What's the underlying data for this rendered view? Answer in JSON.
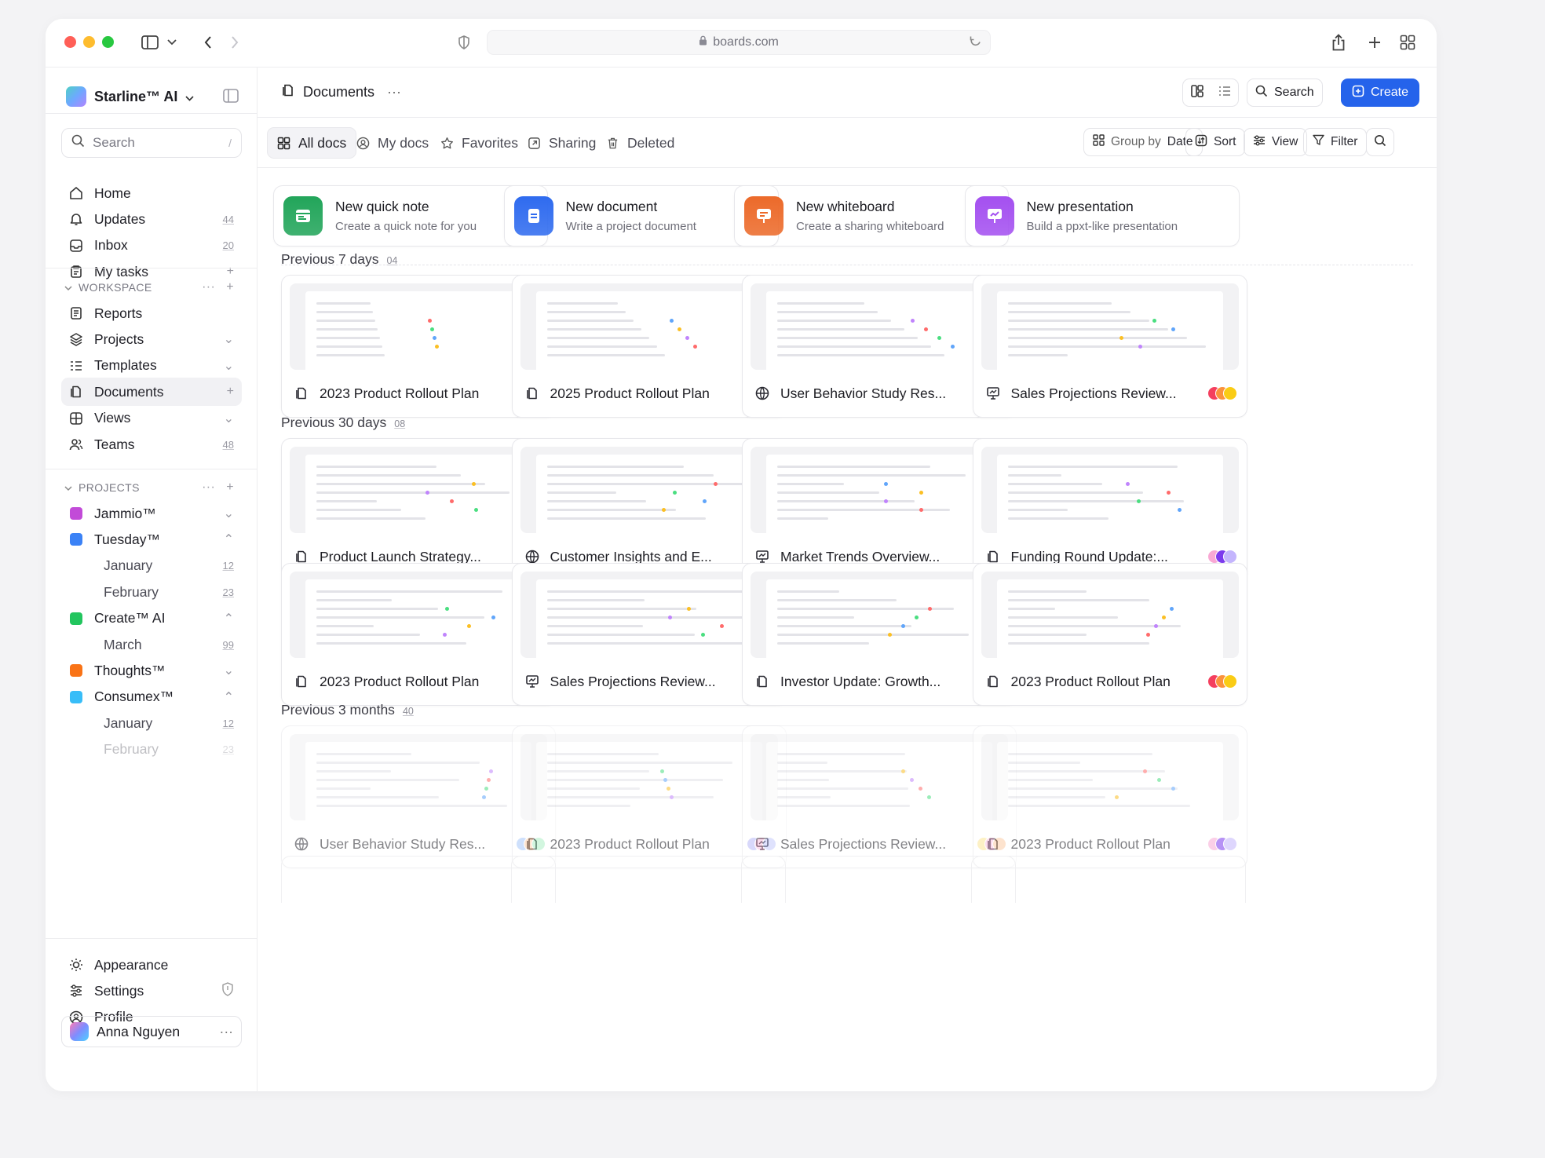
{
  "browser": {
    "url": "boards.com"
  },
  "sidebar": {
    "brand": "Starline™ AI",
    "search_placeholder": "Search",
    "search_shortcut": "/",
    "main_nav": [
      {
        "label": "Home",
        "icon": "home-icon",
        "right": ""
      },
      {
        "label": "Updates",
        "icon": "bell-icon",
        "right": "44"
      },
      {
        "label": "Inbox",
        "icon": "inbox-icon",
        "right": "20"
      },
      {
        "label": "My tasks",
        "icon": "clipboard-icon",
        "right": "+"
      }
    ],
    "workspace_label": "WORKSPACE",
    "workspace": [
      {
        "label": "Reports",
        "icon": "report-icon",
        "right": ""
      },
      {
        "label": "Projects",
        "icon": "layers-icon",
        "right": "⌄"
      },
      {
        "label": "Templates",
        "icon": "template-icon",
        "right": "⌄"
      },
      {
        "label": "Documents",
        "icon": "document-icon",
        "right": "+",
        "active": true
      },
      {
        "label": "Views",
        "icon": "grid-icon",
        "right": "⌄"
      },
      {
        "label": "Teams",
        "icon": "users-icon",
        "right": "48"
      }
    ],
    "projects_label": "PROJECTS",
    "projects": [
      {
        "label": "Jammio™",
        "color": "#c24bd8",
        "right": "⌄"
      },
      {
        "label": "Tuesday™",
        "color": "#3b82f6",
        "right": "⌃"
      },
      {
        "label": "January",
        "sub": true,
        "right": "12"
      },
      {
        "label": "February",
        "sub": true,
        "right": "23"
      },
      {
        "label": "Create™ AI",
        "color": "#22c55e",
        "right": "⌃"
      },
      {
        "label": "March",
        "sub": true,
        "right": "99"
      },
      {
        "label": "Thoughts™",
        "color": "#f97316",
        "right": "⌄"
      },
      {
        "label": "Consumex™",
        "color": "#38bdf8",
        "right": "⌃"
      },
      {
        "label": "January",
        "sub": true,
        "right": "12"
      },
      {
        "label": "February",
        "sub": true,
        "right": "23"
      }
    ],
    "bottom": [
      {
        "label": "Appearance",
        "icon": "sun-icon"
      },
      {
        "label": "Settings",
        "icon": "sliders-icon"
      },
      {
        "label": "Profile",
        "icon": "profile-icon"
      }
    ],
    "user": {
      "name": "Anna Nguyen",
      "more": "···"
    }
  },
  "header": {
    "title": "Documents",
    "more": "···",
    "search_label": "Search",
    "create_label": "Create"
  },
  "toolbar": {
    "tabs": [
      "All docs",
      "My docs",
      "Favorites",
      "Sharing",
      "Deleted"
    ],
    "group_by_prefix": "Group by",
    "group_by_value": "Date",
    "sort_label": "Sort",
    "view_label": "View",
    "filter_label": "Filter"
  },
  "quick_create": [
    {
      "title": "New quick note",
      "subtitle": "Create a quick note for you",
      "color": "#22a55a",
      "icon": "note-icon"
    },
    {
      "title": "New document",
      "subtitle": "Write a project document",
      "color": "#2f6bef",
      "icon": "document-icon"
    },
    {
      "title": "New whiteboard",
      "subtitle": "Create a sharing whiteboard",
      "color": "#ec6a2a",
      "icon": "whiteboard-icon"
    },
    {
      "title": "New presentation",
      "subtitle": "Build a ppxt-like presentation",
      "color": "#a450f0",
      "icon": "presentation-icon"
    }
  ],
  "groups": [
    {
      "label": "Previous 7 days",
      "count": "04",
      "docs": [
        {
          "name": "2023 Product Rollout Plan",
          "icon": "document-icon"
        },
        {
          "name": "2025 Product Rollout Plan",
          "icon": "document-icon"
        },
        {
          "name": "User Behavior Study Res...",
          "icon": "globe-icon"
        },
        {
          "name": "Sales Projections Review...",
          "icon": "presentation-icon"
        }
      ]
    },
    {
      "label": "Previous 30 days",
      "count": "08",
      "docs": [
        {
          "name": "Product Launch Strategy...",
          "icon": "document-icon"
        },
        {
          "name": "Customer Insights and E...",
          "icon": "globe-icon"
        },
        {
          "name": "Market Trends Overview...",
          "icon": "presentation-icon"
        },
        {
          "name": "Funding Round Update:...",
          "icon": "document-icon"
        },
        {
          "name": "2023 Product Rollout Plan",
          "icon": "document-icon"
        },
        {
          "name": "Sales Projections Review...",
          "icon": "presentation-icon"
        },
        {
          "name": "Investor Update: Growth...",
          "icon": "document-icon"
        },
        {
          "name": "2023 Product Rollout Plan",
          "icon": "document-icon"
        }
      ]
    },
    {
      "label": "Previous 3 months",
      "count": "40",
      "docs": [
        {
          "name": "User Behavior Study Res...",
          "icon": "globe-icon"
        },
        {
          "name": "2023 Product Rollout Plan",
          "icon": "document-icon"
        },
        {
          "name": "Sales Projections Review...",
          "icon": "presentation-icon"
        },
        {
          "name": "2023 Product Rollout Plan",
          "icon": "document-icon"
        }
      ]
    }
  ]
}
